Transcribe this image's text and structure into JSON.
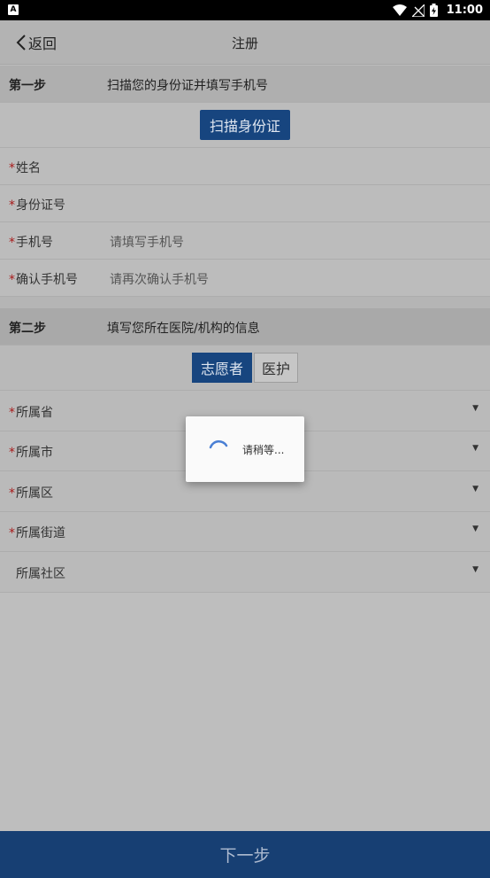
{
  "statusbar": {
    "time": "11:00",
    "app_badge": "A"
  },
  "header": {
    "back_label": "返回",
    "title": "注册"
  },
  "step1": {
    "label": "第一步",
    "desc": "扫描您的身份证并填写手机号",
    "scan_button": "扫描身份证",
    "fields": [
      {
        "label": "姓名",
        "required": true,
        "placeholder": ""
      },
      {
        "label": "身份证号",
        "required": true,
        "placeholder": ""
      },
      {
        "label": "手机号",
        "required": true,
        "placeholder": "请填写手机号"
      },
      {
        "label": "确认手机号",
        "required": true,
        "placeholder": "请再次确认手机号"
      }
    ]
  },
  "step2": {
    "label": "第二步",
    "desc": "填写您所在医院/机构的信息",
    "tabs": [
      "志愿者",
      "医护"
    ],
    "selected_tab": "志愿者",
    "fields": [
      {
        "label": "所属省",
        "required": true
      },
      {
        "label": "所属市",
        "required": true
      },
      {
        "label": "所属区",
        "required": true
      },
      {
        "label": "所属街道",
        "required": true
      },
      {
        "label": "所属社区",
        "required": false
      }
    ]
  },
  "dialog": {
    "message": "请稍等..."
  },
  "footer": {
    "next_label": "下一步"
  },
  "colors": {
    "primary": "#17457f",
    "required_star": "#a81b1b",
    "spinner": "#4a7fd4"
  }
}
